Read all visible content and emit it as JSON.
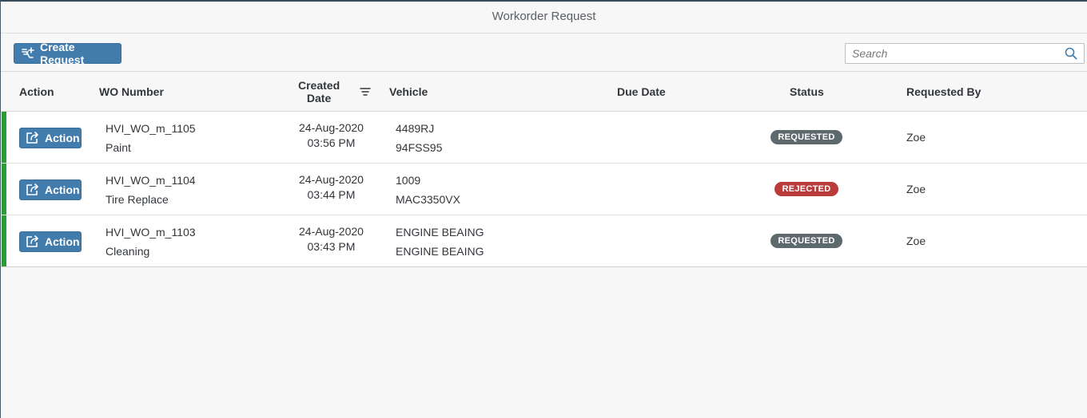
{
  "window": {
    "title": "Workorder Request"
  },
  "toolbar": {
    "create_label": "Create Request",
    "search_placeholder": "Search"
  },
  "table": {
    "columns": {
      "action": "Action",
      "wo_number": "WO Number",
      "created_line1": "Created",
      "created_line2": "Date",
      "vehicle": "Vehicle",
      "due_date": "Due Date",
      "status": "Status",
      "requested_by": "Requested By"
    },
    "rows": [
      {
        "action_label": "Action",
        "wo_number": "HVI_WO_m_1105",
        "description": "Paint",
        "created_date": "24-Aug-2020",
        "created_time": "03:56 PM",
        "vehicle_line1": "4489RJ",
        "vehicle_line2": "94FSS95",
        "due_date": "",
        "status": "REQUESTED",
        "requested_by": "Zoe"
      },
      {
        "action_label": "Action",
        "wo_number": "HVI_WO_m_1104",
        "description": "Tire Replace",
        "created_date": "24-Aug-2020",
        "created_time": "03:44 PM",
        "vehicle_line1": "1009",
        "vehicle_line2": "MAC3350VX",
        "due_date": "",
        "status": "REJECTED",
        "requested_by": "Zoe"
      },
      {
        "action_label": "Action",
        "wo_number": "HVI_WO_m_1103",
        "description": "Cleaning",
        "created_date": "24-Aug-2020",
        "created_time": "03:43 PM",
        "vehicle_line1": "ENGINE BEAING",
        "vehicle_line2": "ENGINE BEAING",
        "due_date": "",
        "status": "REQUESTED",
        "requested_by": "Zoe"
      }
    ]
  },
  "colors": {
    "button": "#427cac",
    "row_highlight": "#2b9b33",
    "status_requested": "#5e696e",
    "status_rejected": "#bb3a3a"
  },
  "icons": {
    "create": "create-request-icon",
    "search": "search-icon",
    "sort": "sort-filter-icon",
    "action": "open-in-new-icon"
  }
}
